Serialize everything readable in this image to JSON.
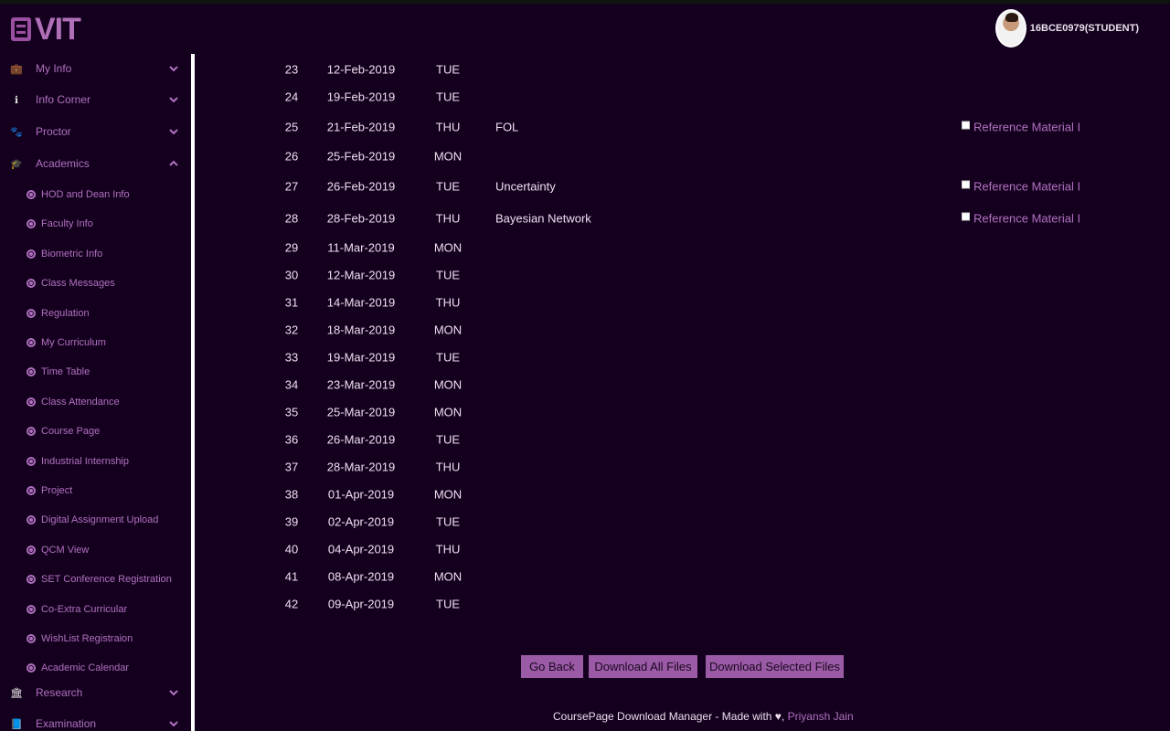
{
  "app": {
    "logo_text": "VIT"
  },
  "user": {
    "name": "16BCE0979(STUDENT)"
  },
  "sidebar": {
    "top_items": [
      {
        "label": "My Info",
        "icon": "briefcase-icon",
        "glyph": "💼",
        "expanded": false
      },
      {
        "label": "Info Corner",
        "icon": "info-icon",
        "glyph": "ℹ",
        "expanded": false
      },
      {
        "label": "Proctor",
        "icon": "paw-icon",
        "glyph": "🐾",
        "expanded": false
      },
      {
        "label": "Academics",
        "icon": "graduation-cap-icon",
        "glyph": "🎓",
        "expanded": true
      }
    ],
    "sub_items": [
      "HOD and Dean Info",
      "Faculty Info",
      "Biometric Info",
      "Class Messages",
      "Regulation",
      "My Curriculum",
      "Time Table",
      "Class Attendance",
      "Course Page",
      "Industrial Internship",
      "Project",
      "Digital Assignment Upload",
      "QCM View",
      "SET Conference Registration",
      "Co-Extra Curricular",
      "WishList Registraion",
      "Academic Calendar"
    ],
    "bottom_items": [
      {
        "label": "Research",
        "icon": "institution-icon",
        "glyph": "🏛",
        "expanded": false
      },
      {
        "label": "Examination",
        "icon": "book-icon",
        "glyph": "📘",
        "expanded": false
      }
    ]
  },
  "table": {
    "rows": [
      {
        "no": "23",
        "date": "12-Feb-2019",
        "day": "TUE",
        "topic": "",
        "ref": ""
      },
      {
        "no": "24",
        "date": "19-Feb-2019",
        "day": "TUE",
        "topic": "",
        "ref": ""
      },
      {
        "no": "25",
        "date": "21-Feb-2019",
        "day": "THU",
        "topic": "FOL",
        "ref": "Reference Material I"
      },
      {
        "no": "26",
        "date": "25-Feb-2019",
        "day": "MON",
        "topic": "",
        "ref": ""
      },
      {
        "no": "27",
        "date": "26-Feb-2019",
        "day": "TUE",
        "topic": "Uncertainty",
        "ref": "Reference Material I"
      },
      {
        "no": "28",
        "date": "28-Feb-2019",
        "day": "THU",
        "topic": "Bayesian Network",
        "ref": "Reference Material I"
      },
      {
        "no": "29",
        "date": "11-Mar-2019",
        "day": "MON",
        "topic": "",
        "ref": ""
      },
      {
        "no": "30",
        "date": "12-Mar-2019",
        "day": "TUE",
        "topic": "",
        "ref": ""
      },
      {
        "no": "31",
        "date": "14-Mar-2019",
        "day": "THU",
        "topic": "",
        "ref": ""
      },
      {
        "no": "32",
        "date": "18-Mar-2019",
        "day": "MON",
        "topic": "",
        "ref": ""
      },
      {
        "no": "33",
        "date": "19-Mar-2019",
        "day": "TUE",
        "topic": "",
        "ref": ""
      },
      {
        "no": "34",
        "date": "23-Mar-2019",
        "day": "MON",
        "topic": "",
        "ref": ""
      },
      {
        "no": "35",
        "date": "25-Mar-2019",
        "day": "MON",
        "topic": "",
        "ref": ""
      },
      {
        "no": "36",
        "date": "26-Mar-2019",
        "day": "TUE",
        "topic": "",
        "ref": ""
      },
      {
        "no": "37",
        "date": "28-Mar-2019",
        "day": "THU",
        "topic": "",
        "ref": ""
      },
      {
        "no": "38",
        "date": "01-Apr-2019",
        "day": "MON",
        "topic": "",
        "ref": ""
      },
      {
        "no": "39",
        "date": "02-Apr-2019",
        "day": "TUE",
        "topic": "",
        "ref": ""
      },
      {
        "no": "40",
        "date": "04-Apr-2019",
        "day": "THU",
        "topic": "",
        "ref": ""
      },
      {
        "no": "41",
        "date": "08-Apr-2019",
        "day": "MON",
        "topic": "",
        "ref": ""
      },
      {
        "no": "42",
        "date": "09-Apr-2019",
        "day": "TUE",
        "topic": "",
        "ref": ""
      }
    ]
  },
  "actions": {
    "go_back": "Go Back",
    "download_all": "Download All Files",
    "download_selected": "Download Selected Files"
  },
  "footer": {
    "text": "CoursePage Download Manager - Made with ♥,",
    "author": "Priyansh Jain"
  },
  "colors": {
    "background": "#14001e",
    "accent": "#b070c0",
    "button": "#9b5aa6"
  }
}
